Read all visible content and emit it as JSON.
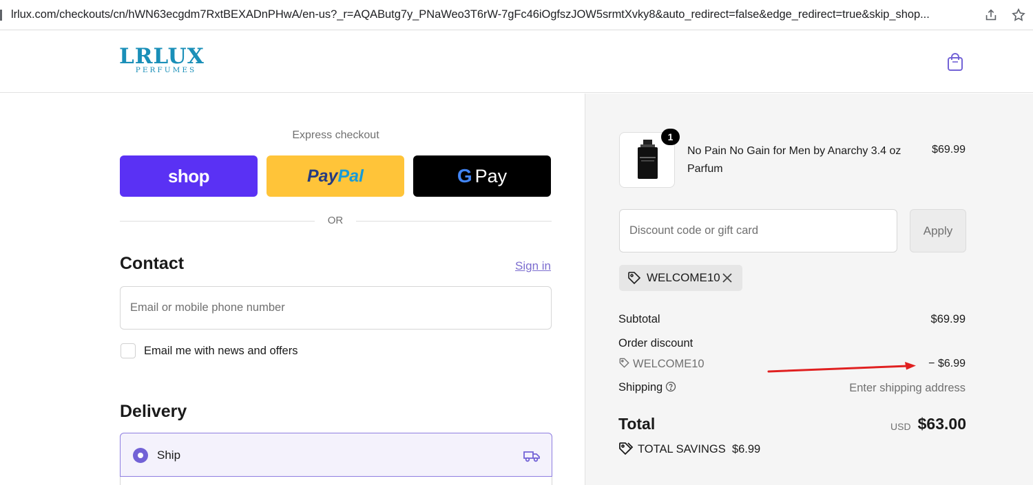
{
  "browser": {
    "url": "lrlux.com/checkouts/cn/hWN63ecgdm7RxtBEXADnPHwA/en-us?_r=AQAButg7y_PNaWeo3T6rW-7gFc46iOgfszJOW5srmtXvky8&auto_redirect=false&edge_redirect=true&skip_shop..."
  },
  "header": {
    "logo_main": "LRLUX",
    "logo_sub": "PERFUMES"
  },
  "express": {
    "label": "Express checkout",
    "shop_label": "shop",
    "paypal_part1": "Pay",
    "paypal_part2": "Pal",
    "gpay_g": "G",
    "gpay_label": "Pay",
    "or": "OR"
  },
  "contact": {
    "title": "Contact",
    "sign_in": "Sign in",
    "email_placeholder": "Email or mobile phone number",
    "news_label": "Email me with news and offers"
  },
  "delivery": {
    "title": "Delivery",
    "ship_label": "Ship"
  },
  "summary": {
    "product_name": "No Pain No Gain for Men by Anarchy 3.4 oz Parfum",
    "product_price": "$69.99",
    "quantity": "1",
    "discount_placeholder": "Discount code or gift card",
    "apply_label": "Apply",
    "applied_code": "WELCOME10",
    "subtotal_label": "Subtotal",
    "subtotal_value": "$69.99",
    "order_discount_label": "Order discount",
    "discount_code": "WELCOME10",
    "discount_value": "− $6.99",
    "shipping_label": "Shipping",
    "shipping_value": "Enter shipping address",
    "total_label": "Total",
    "currency": "USD",
    "total_value": "$63.00",
    "savings_label": "TOTAL SAVINGS",
    "savings_value": "$6.99"
  },
  "colors": {
    "shop_pay": "#5a31f4",
    "paypal": "#ffc439",
    "gpay": "#000000",
    "accent": "#7262d6",
    "logo": "#1a8fb8",
    "annotation_arrow": "#e02020"
  }
}
